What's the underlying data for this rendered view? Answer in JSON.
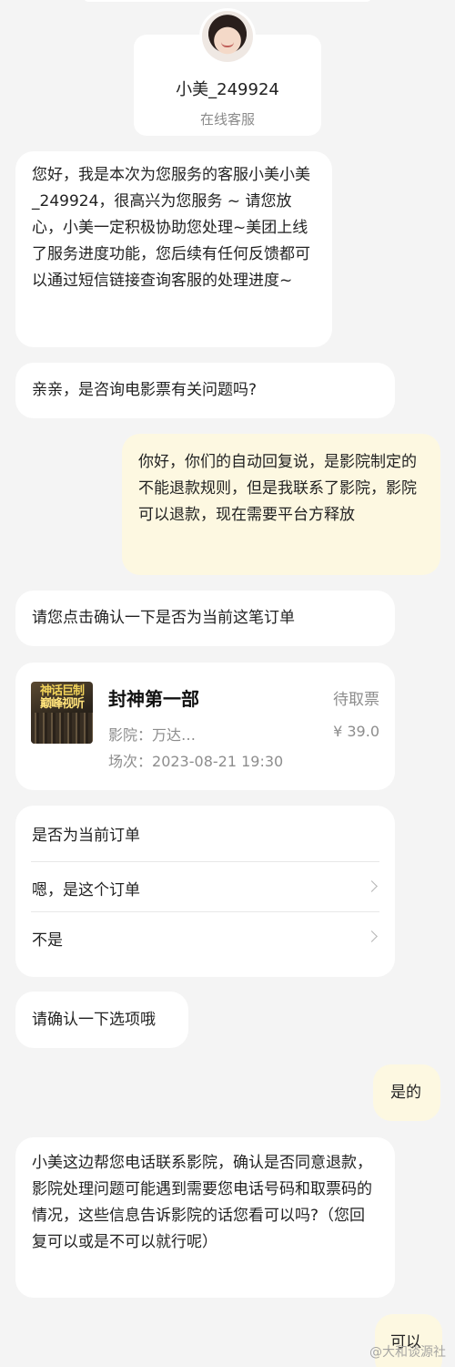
{
  "agent": {
    "name": "小美_249924",
    "role": "在线客服"
  },
  "messages": [
    {
      "from": "agent",
      "text": "您好，我是本次为您服务的客服小美小美_249924，很高兴为您服务 ~ 请您放心，小美一定积极协助您处理~美团上线了服务进度功能，您后续有任何反馈都可以通过短信链接查询客服的处理进度~"
    },
    {
      "from": "agent",
      "text": "亲亲，是咨询电影票有关问题吗?"
    },
    {
      "from": "user",
      "text": "你好，你们的自动回复说，是影院制定的不能退款规则，但是我联系了影院，影院可以退款，现在需要平台方释放"
    },
    {
      "from": "agent",
      "text": "请您点击确认一下是否为当前这笔订单"
    },
    {
      "from": "agent",
      "text": "请确认一下选项哦"
    },
    {
      "from": "user",
      "text": "是的"
    },
    {
      "from": "agent",
      "text": "小美这边帮您电话联系影院，确认是否同意退款，影院处理问题可能遇到需要您电话号码和取票码的情况，这些信息告诉影院的话您看可以吗?（您回复可以或是不可以就行呢）"
    },
    {
      "from": "user",
      "text": "可以"
    }
  ],
  "order": {
    "poster_text_line1": "神话巨制",
    "poster_text_line2": "巅峰视听",
    "movie_title": "封神第一部",
    "status": "待取票",
    "cinema_label": "影院：",
    "cinema_value": "万达…",
    "price": "¥ 39.0",
    "session_label": "场次：",
    "session_value": "2023-08-21 19:30"
  },
  "confirm": {
    "question": "是否为当前订单",
    "options": [
      "嗯，是这个订单",
      "不是"
    ]
  },
  "watermark": "@大和谈源社",
  "colors": {
    "background": "#f4f4f4",
    "agent_bubble": "#ffffff",
    "user_bubble": "#fdf8e1",
    "muted_text": "#8d8d8d"
  }
}
